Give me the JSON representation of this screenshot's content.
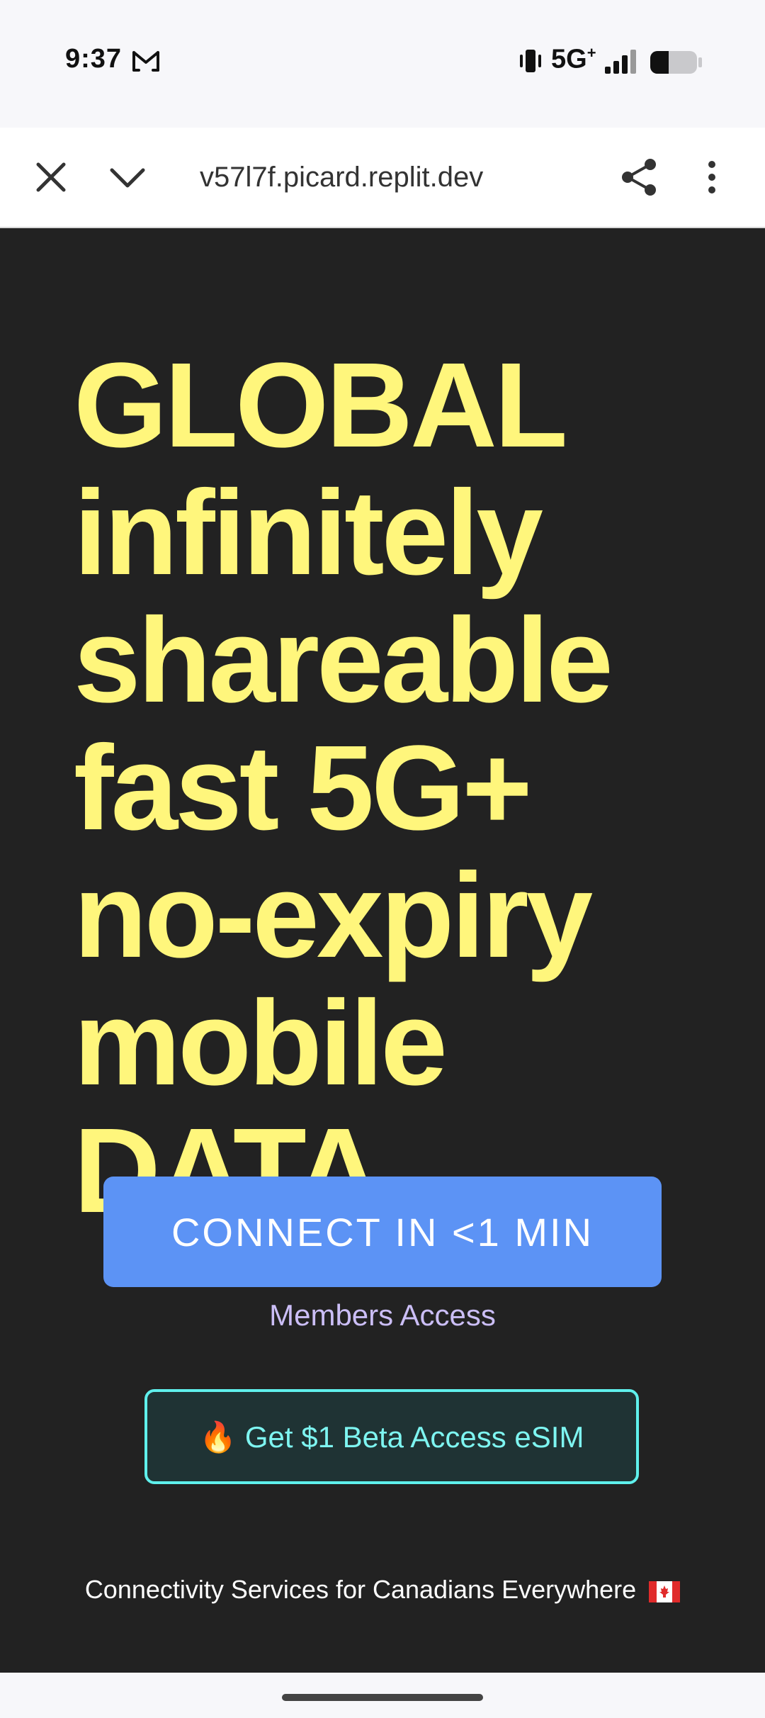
{
  "status_bar": {
    "time": "9:37",
    "network": "5G",
    "network_suffix": "+",
    "icons": [
      "gmail-icon",
      "vibrate-icon",
      "signal-icon",
      "battery-icon"
    ]
  },
  "browser": {
    "url": "v57l7f.picard.replit.dev",
    "icons": [
      "close-icon",
      "chevron-down-icon",
      "share-icon",
      "more-icon"
    ]
  },
  "hero": {
    "lines": [
      "GLOBAL",
      "infinitely",
      "shareable",
      "fast 5G+",
      "no-expiry",
      "mobile",
      "DATA"
    ]
  },
  "connect_button": {
    "label": "CONNECT IN <1 MIN"
  },
  "members_link": {
    "label": "Members Access"
  },
  "beta_button": {
    "icon": "🔥",
    "label": "Get $1 Beta Access eSIM"
  },
  "footer": {
    "text": "Connectivity Services for Canadians Everywhere"
  },
  "colors": {
    "background": "#222222",
    "hero_text": "#fff67c",
    "connect_button": "#5c93f5",
    "members_link": "#cbbef6",
    "beta_border": "#5ff0ec",
    "beta_text": "#7ef5f1"
  }
}
